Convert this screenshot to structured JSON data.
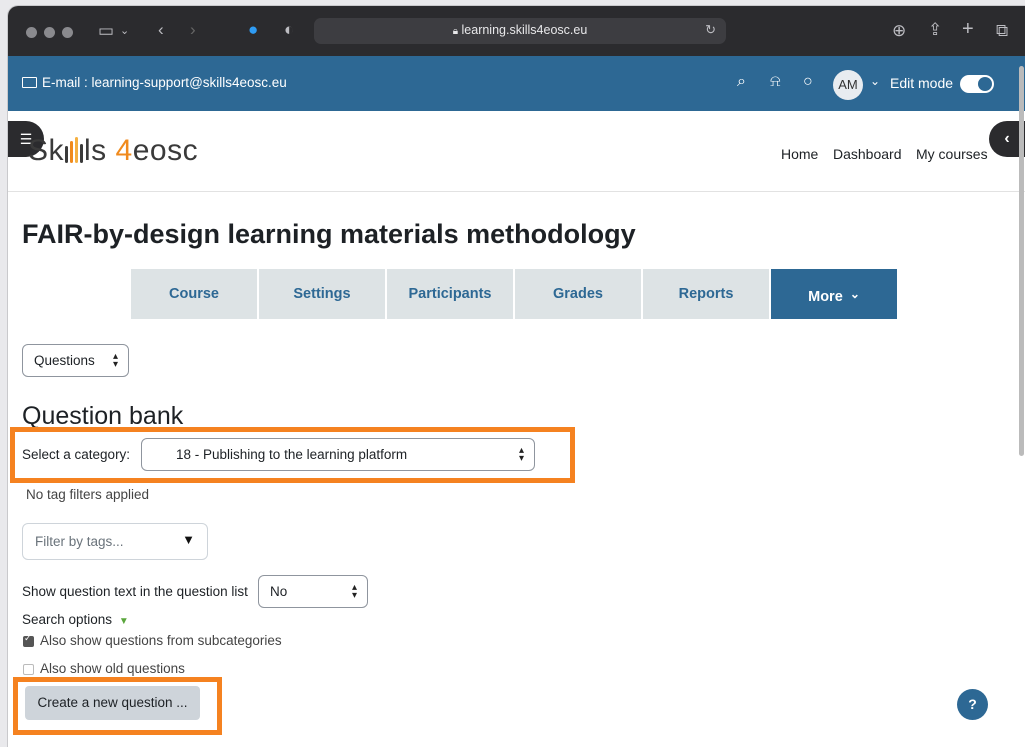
{
  "browser": {
    "url": "learning.skills4eosc.eu",
    "icons": [
      "window-dots",
      "sidebar-icon",
      "chevron-down-icon",
      "back-icon",
      "forward-icon",
      "extension-icon",
      "shield-icon",
      "lock-icon",
      "reload-icon",
      "download-icon",
      "share-icon",
      "new-tab-icon",
      "tabs-overview-icon"
    ]
  },
  "topbar": {
    "email_label": "E-mail : learning-support@skills4eosc.eu",
    "avatar_initials": "AM",
    "edit_mode_label": "Edit mode",
    "edit_mode_on": true,
    "bg_color": "#2d6894"
  },
  "site": {
    "logo_text_a": "Sk",
    "logo_text_b": "ls",
    "logo_four": "4",
    "logo_text_c": "eosc",
    "nav": [
      "Home",
      "Dashboard",
      "My courses"
    ]
  },
  "page": {
    "title": "FAIR-by-design learning materials methodology",
    "tabs": [
      "Course",
      "Settings",
      "Participants",
      "Grades",
      "Reports",
      "More"
    ],
    "more_caret": "⌄",
    "questions_select": "Questions",
    "heading": "Question bank",
    "category_label": "Select a category:",
    "category_value": "18 - Publishing to the learning platform",
    "no_tag_filters": "No tag filters applied",
    "filter_placeholder": "Filter by tags...",
    "show_text_label": "Show question text in the question list",
    "show_text_value": "No",
    "search_options": "Search options",
    "subcategories_label": "Also show questions from subcategories",
    "subcategories_checked": true,
    "old_questions_label": "Also show old questions",
    "old_questions_checked": false,
    "create_button": "Create a new question ...",
    "help": "?",
    "highlight_color": "#f58220"
  }
}
